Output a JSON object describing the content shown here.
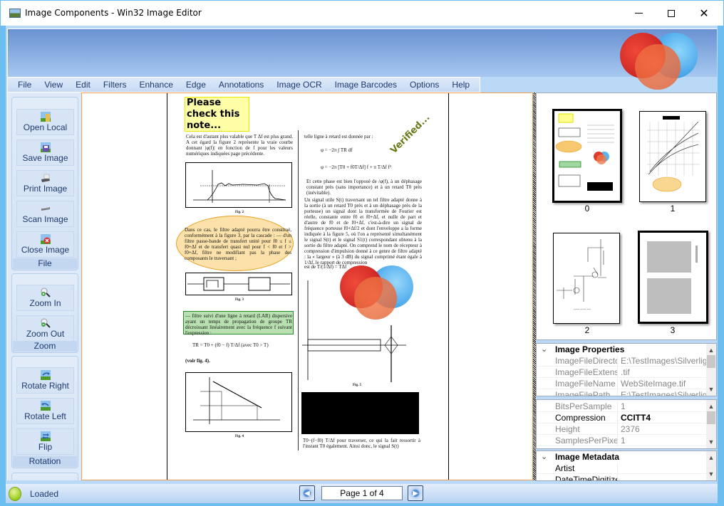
{
  "window": {
    "title": "Image Components - Win32 Image Editor",
    "controls": {
      "minimize": "minimize",
      "maximize": "maximize",
      "close": "close"
    }
  },
  "menu": {
    "items": [
      "File",
      "View",
      "Edit",
      "Filters",
      "Enhance",
      "Edge",
      "Annotations",
      "Image OCR",
      "Image Barcodes",
      "Options",
      "Help"
    ]
  },
  "sidebar": {
    "groups": [
      {
        "label": "File",
        "buttons": [
          {
            "label": "Open Local",
            "icon": "open-folder-icon"
          },
          {
            "label": "Save Image",
            "icon": "save-disk-icon"
          },
          {
            "label": "Print Image",
            "icon": "printer-icon"
          },
          {
            "label": "Scan Image",
            "icon": "scanner-icon"
          },
          {
            "label": "Close Image",
            "icon": "close-image-icon"
          }
        ]
      },
      {
        "label": "Zoom",
        "buttons": [
          {
            "label": "Zoom In",
            "icon": "zoom-in-icon"
          },
          {
            "label": "Zoom Out",
            "icon": "zoom-out-icon"
          }
        ]
      },
      {
        "label": "Rotation",
        "buttons": [
          {
            "label": "Rotate Right",
            "icon": "rotate-right-icon"
          },
          {
            "label": "Rotate Left",
            "icon": "rotate-left-icon"
          },
          {
            "label": "Flip",
            "icon": "flip-icon"
          }
        ]
      }
    ]
  },
  "document": {
    "sticky_note": "Please check this note...",
    "stamp": "Verified...",
    "left_col_para1": "Cela est d'autant plus valable que T Δf est plus grand. A cet égard la figure 2 représente la vraie courbe donnant |φ(f)| en fonction de f pour les valeurs numériques indiquées page précédente.",
    "fig2_caption": "Fig. 2",
    "ellipse_text": "Dans ce cas, le filtre adapté pourra être constitué, conformément à la figure 3, par la cascade : — d'un filtre passe-bande de transfert unité pour f0 ≤ f ≤ f0+Δf et de transfert quasi nul pour f < f0 et f > f0+Δf, filtre ne modifiant pas la phase des composants le traversant ;",
    "fig3_caption": "Fig. 3",
    "green_text": "— filtre suivi d'une ligne à retard (LAR) dispersive ayant un temps de propagation de groupe TR décroissant linéairement avec la fréquence f suivant l'expression :",
    "equation": "TR = T0 + (f0 − f) T/Δf  (avec T0 > T)",
    "voir": "(voir fig. 4).",
    "fig4_caption": "Fig. 4",
    "right_col_intro": "telle ligne à retard est donnée par :",
    "eq1": "φ = −2π ∫ TR df",
    "eq2": "φ = −2π [T0 + f0T/Δf] f + π T/Δf f²",
    "right_col_para1": "Et cette phase est bien l'opposé de /φ(f), à un déphasage constant près (sans importance) et à un retard T0 près (inévitable).",
    "right_col_para2": "Un signal utile S(t) traversant un tel filtre adapté donne à la sortie (à un retard T0 près et à un déphasage près de la porteuse) un signal dont la transformée de Fourier est réelle, constante entre f0 et f0+Δf, et nulle de part et d'autre de f0 et de f0+Δf, c'est-à-dire un signal de fréquence porteuse f0+Δf/2 et dont l'enveloppe a la forme indiquée à la figure 5, où l'on a représenté simultanément le signal S(t) et le signal S1(t) correspondant obtenu à la sortie du filtre adapté. On comprend le nom de récepteur à compression d'impulsion donné à ce genre de filtre adapté : la « largeur » (à 3 dB) du signal comprimé étant égale à 1/Δf, le rapport de compression",
    "compression_eq": "est de T/(1/Δf) = TΔf",
    "fig5_caption": "Fig. 5",
    "bottom_text": "T0−(f−f0) T/Δf pour traverser, ce qui la fait ressortir à l'instant T0 également. Ainsi donc, le signal S(t)"
  },
  "thumbnails": [
    {
      "label": "0",
      "selected": true
    },
    {
      "label": "1",
      "selected": false
    },
    {
      "label": "2",
      "selected": false
    },
    {
      "label": "3",
      "selected": true
    }
  ],
  "properties": {
    "image_properties": {
      "title": "Image Properties",
      "rows": [
        {
          "key": "ImageFileDirectory",
          "value": "E:\\TestImages\\Silverligh"
        },
        {
          "key": "ImageFileExtension",
          "value": ".tif"
        },
        {
          "key": "ImageFileName",
          "value": "WebSiteImage.tif"
        },
        {
          "key": "ImageFilePath",
          "value": "E:\\TestImages\\Silverligh"
        }
      ]
    },
    "tiff_tags": {
      "rows": [
        {
          "key": "BitsPerSample",
          "value": "1"
        },
        {
          "key": "Compression",
          "value": "CCITT4",
          "active": true
        },
        {
          "key": "Height",
          "value": "2376"
        },
        {
          "key": "SamplesPerPixel",
          "value": "1"
        }
      ]
    },
    "image_metadata": {
      "title": "Image Metadata",
      "rows": [
        {
          "key": "Artist",
          "value": ""
        },
        {
          "key": "DateTimeDigitized",
          "value": ""
        }
      ]
    }
  },
  "status": {
    "text": "Loaded",
    "page_indicator": "Page 1 of 4"
  },
  "colors": {
    "accent_blue": "#6cbdf0",
    "menu_text": "#1e3a6e",
    "viewer_border": "#f0a050"
  }
}
